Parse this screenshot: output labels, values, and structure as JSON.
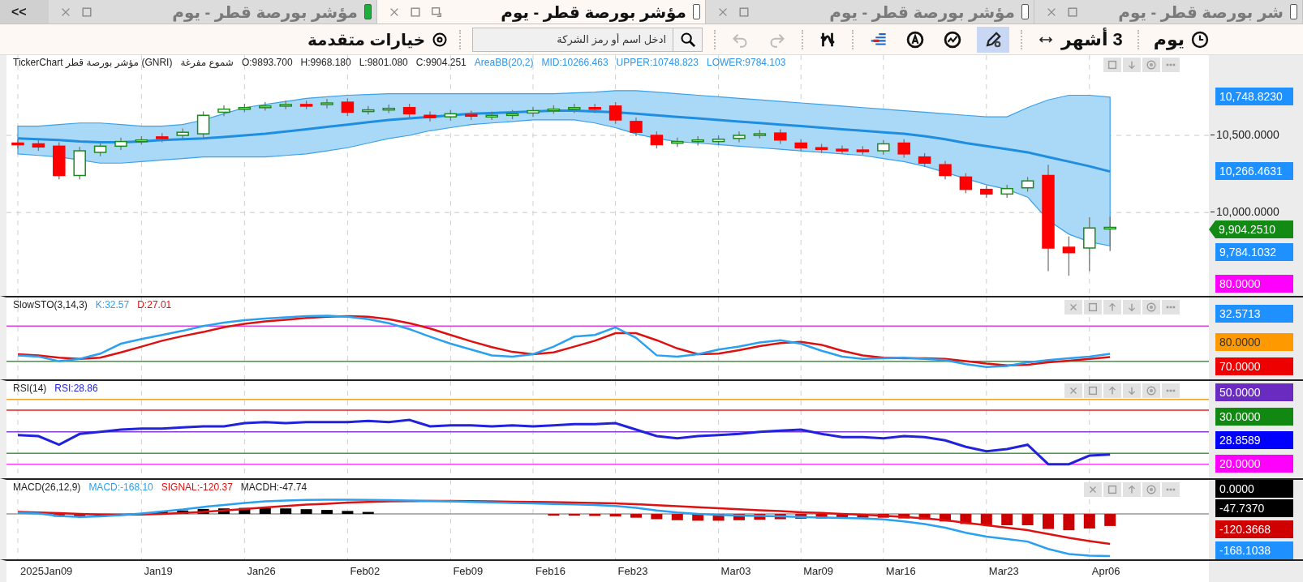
{
  "tab_bar": {
    "tabs": [
      {
        "label": "شر بورصة قطر - يوم",
        "selected": false,
        "color": "#ffffff"
      },
      {
        "label": "مؤشر بورصة قطر - يوم",
        "selected": false,
        "color": "#ffffff"
      },
      {
        "label": "مؤشر بورصة قطر - يوم",
        "selected": true,
        "color": "#ffffff"
      },
      {
        "label": "مؤشر بورصة قطر - يوم",
        "selected": false,
        "color": "#1fae3c"
      }
    ],
    "collapse": "<<"
  },
  "toolbar": {
    "advanced_options": "خيارات متقدمة",
    "search": {
      "placeholder": "ادخل اسم أو رمز الشركة"
    },
    "undo": {
      "disabled": true
    },
    "redo": {
      "disabled": true
    },
    "drawing_tool": {
      "selected": true
    },
    "range": "3 أشهر",
    "period": "يوم"
  },
  "panels": [
    {
      "legend": [
        {
          "text": "TickerChart مؤشر بورصة قطر (GNRI)",
          "color": "#222222"
        },
        {
          "text": "شموع مفرغة",
          "color": "#222222"
        },
        {
          "text": "O:9893.700",
          "color": "#222222"
        },
        {
          "text": "H:9968.180",
          "color": "#222222"
        },
        {
          "text": "L:9801.080",
          "color": "#222222"
        },
        {
          "text": "C:9904.251",
          "color": "#222222"
        },
        {
          "text": "AreaBB(20,2)",
          "color": "#2f95e8"
        },
        {
          "text": "MID:10266.463",
          "color": "#2f95e8"
        },
        {
          "text": "UPPER:10748.823",
          "color": "#2f95e8"
        },
        {
          "text": "LOWER:9784.103",
          "color": "#2f95e8"
        }
      ],
      "controls": [
        {
          "kind": "maximize"
        },
        {
          "kind": "down"
        },
        {
          "kind": "settings"
        },
        {
          "kind": "more"
        }
      ],
      "axis_labels": [
        {
          "text": "10,748.8230",
          "kind": "badge",
          "color": "#1e90ff"
        },
        {
          "text": "10,500.0000",
          "kind": "tick"
        },
        {
          "text": "10,266.4631",
          "kind": "badge",
          "color": "#1e90ff"
        },
        {
          "text": "10,000.0000",
          "kind": "tick"
        },
        {
          "text": "9,904.2510",
          "kind": "tag",
          "color": "#138a13"
        },
        {
          "text": "9,784.1032",
          "kind": "badge",
          "color": "#1e90ff"
        },
        {
          "text": "80.0000",
          "kind": "badge",
          "color": "#ff00ff"
        }
      ]
    },
    {
      "legend": [
        {
          "text": "SlowSTO(3,14,3)",
          "color": "#222222"
        },
        {
          "text": "K:32.57",
          "color": "#2aa0f0"
        },
        {
          "text": "D:27.01",
          "color": "#dd1111"
        }
      ],
      "controls": [
        {
          "kind": "close"
        },
        {
          "kind": "maximize"
        },
        {
          "kind": "up"
        },
        {
          "kind": "down"
        },
        {
          "kind": "settings"
        },
        {
          "kind": "more"
        }
      ],
      "axis_labels": [
        {
          "text": "32.5713",
          "kind": "badge",
          "color": "#1e90ff"
        },
        {
          "text": "80.0000",
          "kind": "badge_light",
          "color": "#ff9900"
        },
        {
          "text": "70.0000",
          "kind": "badge",
          "color": "#ee0000"
        }
      ]
    },
    {
      "legend": [
        {
          "text": "RSI(14)",
          "color": "#222222"
        },
        {
          "text": "RSI:28.86",
          "color": "#2222dd"
        }
      ],
      "controls": [
        {
          "kind": "close"
        },
        {
          "kind": "maximize"
        },
        {
          "kind": "up"
        },
        {
          "kind": "down"
        },
        {
          "kind": "settings"
        },
        {
          "kind": "more"
        }
      ],
      "axis_labels": [
        {
          "text": "50.0000",
          "kind": "badge",
          "color": "#6a2bc0"
        },
        {
          "text": "30.0000",
          "kind": "badge",
          "color": "#118811"
        },
        {
          "text": "28.8589",
          "kind": "badge",
          "color": "#0000ff"
        },
        {
          "text": "20.0000",
          "kind": "badge",
          "color": "#ff00ff"
        }
      ]
    },
    {
      "legend": [
        {
          "text": "MACD(26,12,9)",
          "color": "#222222"
        },
        {
          "text": "MACD:-168.10",
          "color": "#2aa0f0"
        },
        {
          "text": "SIGNAL:-120.37",
          "color": "#dd1111"
        },
        {
          "text": "MACDH:-47.74",
          "color": "#222222"
        }
      ],
      "controls": [
        {
          "kind": "close"
        },
        {
          "kind": "maximize"
        },
        {
          "kind": "up"
        },
        {
          "kind": "settings"
        },
        {
          "kind": "more"
        }
      ],
      "axis_labels": [
        {
          "text": "0.0000",
          "kind": "badge",
          "color": "#000000"
        },
        {
          "text": "-47.7370",
          "kind": "badge",
          "color": "#000000"
        },
        {
          "text": "-120.3668",
          "kind": "badge",
          "color": "#d00000"
        },
        {
          "text": "-168.1038",
          "kind": "badge",
          "color": "#1e90ff"
        }
      ]
    }
  ],
  "date_axis": [
    "2025Jan09",
    "Jan19",
    "Jan26",
    "Feb02",
    "Feb09",
    "Feb16",
    "Feb23",
    "Mar03",
    "Mar09",
    "Mar16",
    "Mar23",
    "Apr06"
  ]
}
